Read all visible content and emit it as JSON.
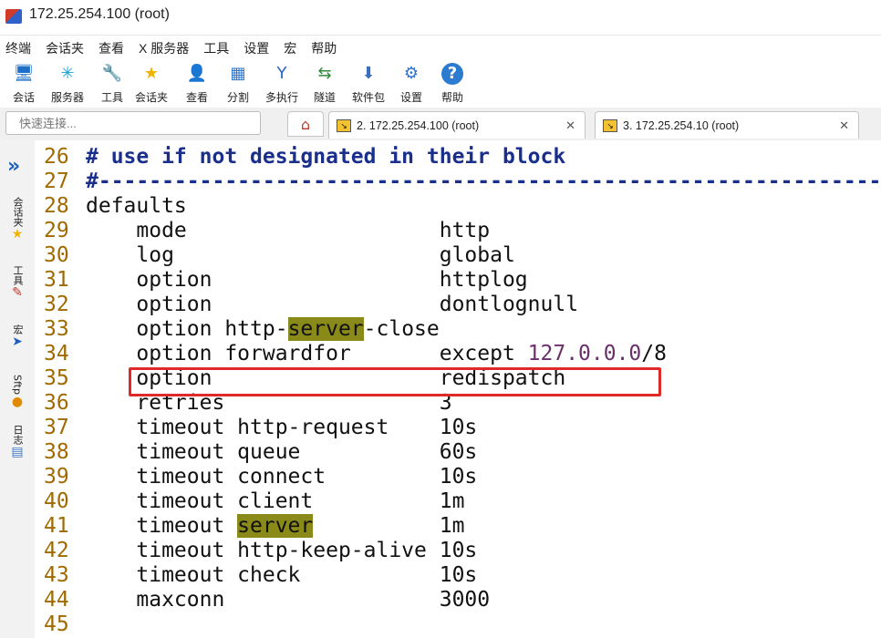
{
  "window": {
    "title": "172.25.254.100 (root)"
  },
  "menu": [
    "终端",
    "会话夹",
    "查看",
    "X 服务器",
    "工具",
    "设置",
    "宏",
    "帮助"
  ],
  "toolbar": [
    {
      "label": "会话",
      "icon": "session-icon",
      "glyph": "🖥",
      "color": "#1d6fc7"
    },
    {
      "label": "服务器",
      "icon": "servers-icon",
      "glyph": "✳",
      "color": "#1aa1d6"
    },
    {
      "label": "工具",
      "icon": "tools-icon",
      "glyph": "🔧",
      "color": "#c0392b"
    },
    {
      "label": "会话夹",
      "icon": "star-icon",
      "glyph": "★",
      "color": "#f0b400"
    },
    {
      "label": "查看",
      "icon": "view-icon",
      "glyph": "👤",
      "color": "#2b7bd1"
    },
    {
      "label": "分割",
      "icon": "split-icon",
      "glyph": "▦",
      "color": "#2f75c9"
    },
    {
      "label": "多执行",
      "icon": "multiexec-icon",
      "glyph": "Y",
      "color": "#2a66c4"
    },
    {
      "label": "隧道",
      "icon": "tunnel-icon",
      "glyph": "⇆",
      "color": "#2e8b3a"
    },
    {
      "label": "软件包",
      "icon": "package-icon",
      "glyph": "⬇",
      "color": "#3a6fc0"
    },
    {
      "label": "设置",
      "icon": "settings-icon",
      "glyph": "⚙",
      "color": "#2b6fd0"
    },
    {
      "label": "帮助",
      "icon": "help-icon",
      "glyph": "?",
      "color": "#ffffff"
    }
  ],
  "quick_connect": {
    "placeholder": "快速连接..."
  },
  "tabs": [
    {
      "label": "2. 172.25.254.100 (root)"
    },
    {
      "label": "3. 172.25.254.10 (root)"
    }
  ],
  "sidebar": [
    {
      "label": "会话夹",
      "icon": "star-icon",
      "glyph": "★",
      "color": "#f0b400"
    },
    {
      "label": "工具",
      "icon": "tools-icon",
      "glyph": "✎",
      "color": "#c0392b"
    },
    {
      "label": "宏",
      "icon": "macro-icon",
      "glyph": "➤",
      "color": "#1e5fbf"
    },
    {
      "label": "Sftp",
      "icon": "sftp-icon",
      "glyph": "●",
      "color": "#e08a00"
    },
    {
      "label": "日志",
      "icon": "log-icon",
      "glyph": "▤",
      "color": "#3c78c8"
    }
  ],
  "editor": {
    "lines": [
      {
        "n": "26",
        "parts": [
          {
            "t": "# use if not designated in their block",
            "c": "c-comment"
          }
        ]
      },
      {
        "n": "27",
        "parts": [
          {
            "t": "#-----------------------------------------------------------------",
            "c": "c-comment"
          }
        ]
      },
      {
        "n": "28",
        "parts": [
          {
            "t": "defaults"
          }
        ]
      },
      {
        "n": "29",
        "parts": [
          {
            "t": "    mode                    http"
          }
        ]
      },
      {
        "n": "30",
        "parts": [
          {
            "t": "    log                     global"
          }
        ]
      },
      {
        "n": "31",
        "parts": [
          {
            "t": "    option                  httplog"
          }
        ]
      },
      {
        "n": "32",
        "parts": [
          {
            "t": "    option                  dontlognull"
          }
        ]
      },
      {
        "n": "33",
        "parts": [
          {
            "t": "    option http-"
          },
          {
            "t": "server",
            "c": "hl"
          },
          {
            "t": "-close"
          }
        ]
      },
      {
        "n": "34",
        "parts": [
          {
            "t": "    option forwardfor       except "
          },
          {
            "t": "127.0.0.0",
            "c": "c-purple"
          },
          {
            "t": "/8"
          }
        ]
      },
      {
        "n": "35",
        "parts": [
          {
            "t": "    option                  redispatch"
          }
        ]
      },
      {
        "n": "36",
        "parts": [
          {
            "t": "    retries                 3"
          }
        ]
      },
      {
        "n": "37",
        "parts": [
          {
            "t": "    timeout http-request    10s"
          }
        ]
      },
      {
        "n": "38",
        "parts": [
          {
            "t": "    timeout queue           60s"
          }
        ]
      },
      {
        "n": "39",
        "parts": [
          {
            "t": "    timeout connect         10s"
          }
        ]
      },
      {
        "n": "40",
        "parts": [
          {
            "t": "    timeout client          1m"
          }
        ]
      },
      {
        "n": "41",
        "parts": [
          {
            "t": "    timeout "
          },
          {
            "t": "server",
            "c": "hl"
          },
          {
            "t": "          1m"
          }
        ]
      },
      {
        "n": "42",
        "parts": [
          {
            "t": "    timeout http-keep-alive 10s"
          }
        ]
      },
      {
        "n": "43",
        "parts": [
          {
            "t": "    timeout check           10s"
          }
        ]
      },
      {
        "n": "44",
        "parts": [
          {
            "t": "    maxconn                 3000"
          }
        ]
      },
      {
        "n": "45",
        "parts": [
          {
            "t": ""
          }
        ]
      }
    ]
  }
}
